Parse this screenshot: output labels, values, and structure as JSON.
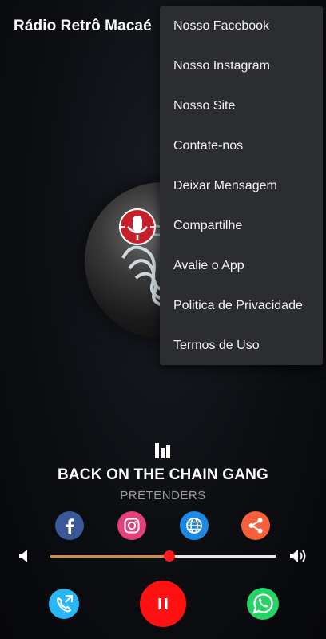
{
  "app": {
    "title": "Rádio Retrô Macaé"
  },
  "menu": {
    "items": [
      {
        "label": "Nosso Facebook"
      },
      {
        "label": "Nosso Instagram"
      },
      {
        "label": "Nosso Site"
      },
      {
        "label": "Contate-nos"
      },
      {
        "label": "Deixar Mensagem"
      },
      {
        "label": "Compartilhe"
      },
      {
        "label": "Avalie o App"
      },
      {
        "label": "Politica de Privacidade"
      },
      {
        "label": "Termos de Uso"
      }
    ]
  },
  "now_playing": {
    "title": "BACK ON THE CHAIN GANG",
    "artist": "PRETENDERS"
  },
  "social": [
    {
      "icon": "facebook-icon",
      "color": "#3b5998"
    },
    {
      "icon": "instagram-icon",
      "color": "#e1306c"
    },
    {
      "icon": "globe-icon",
      "color": "#1e88e5"
    },
    {
      "icon": "share-icon",
      "color": "#ff5722"
    }
  ],
  "volume": {
    "level_fraction": 0.53
  },
  "controls": {
    "call_color": "#29b6f6",
    "pause_color": "#ff1111",
    "whatsapp_color": "#25d366"
  }
}
